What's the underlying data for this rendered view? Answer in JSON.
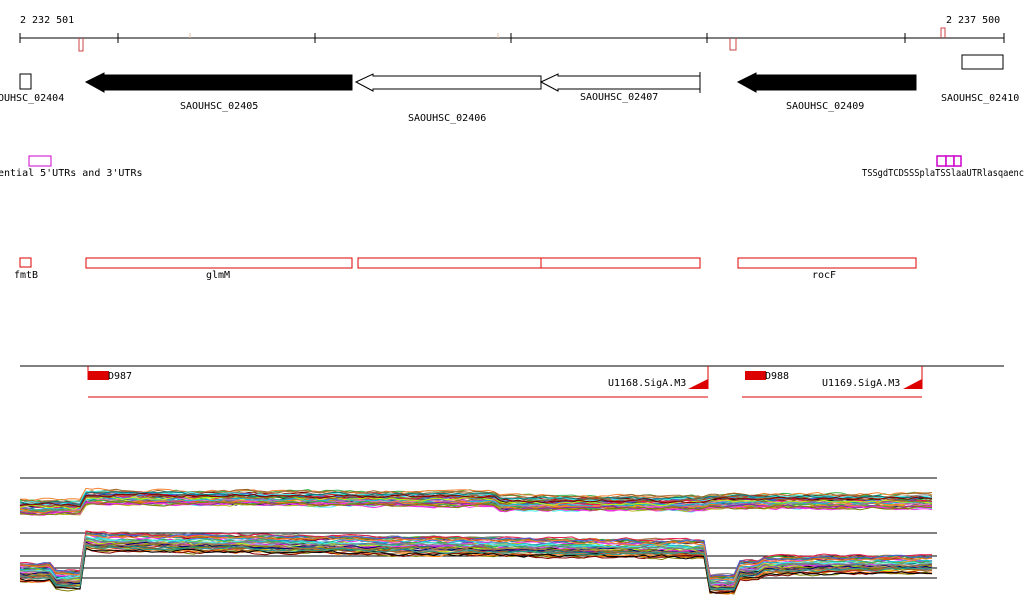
{
  "colors": {
    "axis": "#000000",
    "gene_filled": "#000000",
    "gene_outline": "#000000",
    "utr": "#cc00cc",
    "annotation": "#dd0000",
    "tick_marker": "#cc4444",
    "background": "#ffffff"
  },
  "ruler": {
    "start_label": "2 232 501",
    "end_label": "2 237 500"
  },
  "genes": [
    {
      "id": "SAOUHSC_02404",
      "label": "OUHSC_02404",
      "style": "box"
    },
    {
      "id": "SAOUHSC_02405",
      "label": "SAOUHSC_02405",
      "style": "filled-left"
    },
    {
      "id": "SAOUHSC_02406",
      "label": "SAOUHSC_02406",
      "style": "outline-left"
    },
    {
      "id": "SAOUHSC_02407",
      "label": "SAOUHSC_02407",
      "style": "outline-left"
    },
    {
      "id": "SAOUHSC_02409",
      "label": "SAOUHSC_02409",
      "style": "filled-left"
    },
    {
      "id": "SAOUHSC_02410",
      "label": "SAOUHSC_02410",
      "style": "box"
    }
  ],
  "utr_track": {
    "label": "ential 5'UTRs and 3'UTRs",
    "right_label": "TSSgdTCDSSSplaTSSlaaUTRlasqaenc"
  },
  "annotation_genes": [
    {
      "id": "fmtB",
      "label": "fmtB"
    },
    {
      "id": "glmM",
      "label": "glmM"
    },
    {
      "id": "anno-3",
      "label": ""
    },
    {
      "id": "anno-4",
      "label": ""
    },
    {
      "id": "rocF",
      "label": "rocF"
    }
  ],
  "operons": [
    {
      "id": "D987",
      "tss_label": "D987",
      "sig_label": "U1168.SigA.M3"
    },
    {
      "id": "D988",
      "tss_label": "D988",
      "sig_label": "U1169.SigA.M3"
    }
  ],
  "tracks": {
    "expression_upper": "expression-profile-upper",
    "expression_lower": "expression-profile-lower"
  }
}
